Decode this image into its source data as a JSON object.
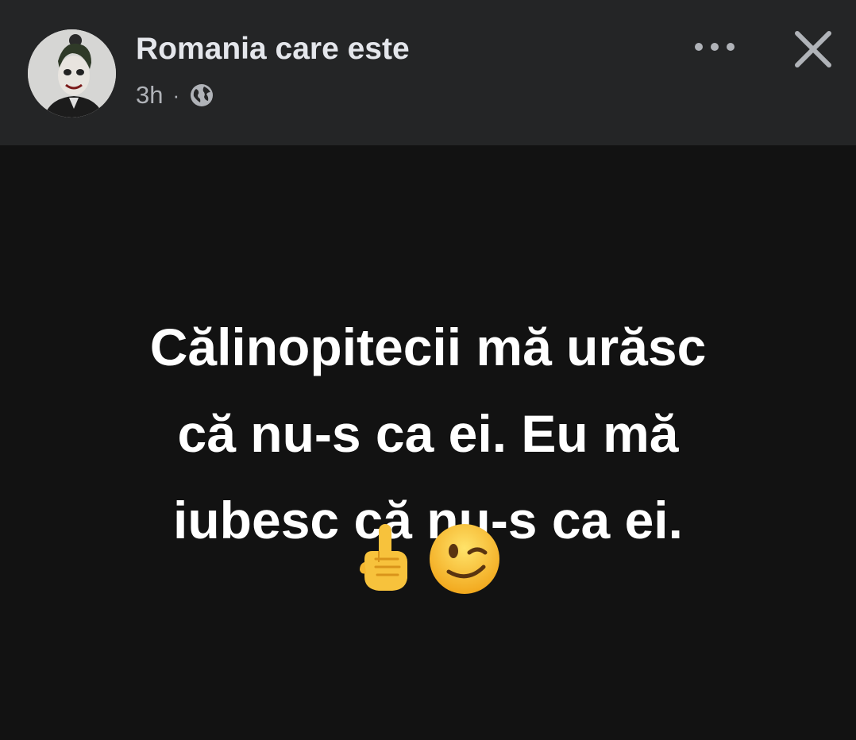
{
  "post": {
    "author": "Romania care este",
    "time": "3h",
    "separator": "·",
    "privacy_icon": "globe-icon",
    "text": "Călinopitecii mă urăsc\ncă nu-s ca ei. Eu mă\niubesc că nu-s ca ei.",
    "emojis": [
      "point-up-icon",
      "winking-face-icon"
    ]
  },
  "header": {
    "more_icon": "more-options-icon",
    "close_icon": "close-icon"
  },
  "colors": {
    "header_bg": "#242526",
    "body_bg": "#121212",
    "text_primary": "#e4e6eb",
    "text_secondary": "#b0b3b8",
    "post_text": "#ffffff"
  }
}
